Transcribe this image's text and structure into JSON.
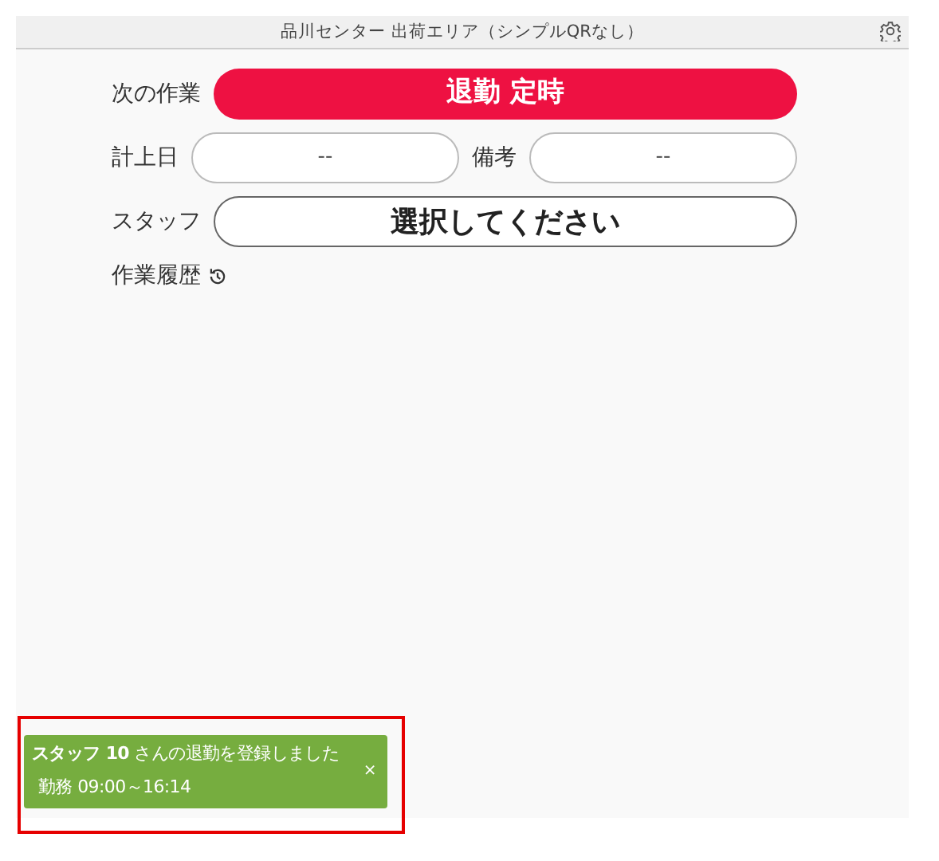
{
  "header": {
    "title": "品川センター 出荷エリア（シンプルQRなし）"
  },
  "form": {
    "next_task": {
      "label": "次の作業",
      "value": "退勤 定時"
    },
    "date": {
      "label": "計上日",
      "value": "--"
    },
    "note": {
      "label": "備考",
      "value": "--"
    },
    "staff": {
      "label": "スタッフ",
      "value": "選択してください"
    },
    "history": {
      "label": "作業履歴"
    }
  },
  "toast": {
    "message": "**スタッフ 10** さんの退勤を登録しました",
    "detail": "勤務 09:00～16:14",
    "close": "×"
  },
  "highlight": {
    "shown": true
  }
}
